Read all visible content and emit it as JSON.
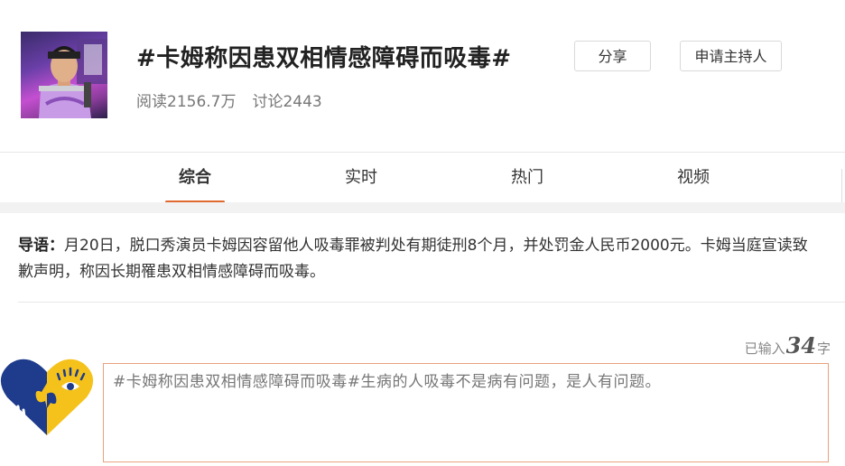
{
  "topic": {
    "title": "#卡姆称因患双相情感障碍而吸毒#",
    "reads": "阅读2156.7万",
    "discussions": "讨论2443"
  },
  "buttons": {
    "share": "分享",
    "apply_host": "申请主持人"
  },
  "tabs": [
    {
      "label": "综合",
      "active": true
    },
    {
      "label": "实时",
      "active": false
    },
    {
      "label": "热门",
      "active": false
    },
    {
      "label": "视频",
      "active": false
    }
  ],
  "guide": {
    "label": "导语：",
    "text": "月20日，脱口秀演员卡姆因容留他人吸毒罪被判处有期徒刑8个月，并处罚金人民币2000元。卡姆当庭宣读致歉声明，称因长期罹患双相情感障碍而吸毒。"
  },
  "composer": {
    "counter_prefix": "已输入",
    "counter_value": "34",
    "counter_suffix": "字",
    "text": "#卡姆称因患双相情感障碍而吸毒#生病的人吸毒不是病有问题，是人有问题。"
  },
  "colors": {
    "accent": "#e06a2f",
    "logo_blue": "#1e3b8c",
    "logo_yellow": "#f5c21b",
    "input_border": "#e8a27e"
  }
}
